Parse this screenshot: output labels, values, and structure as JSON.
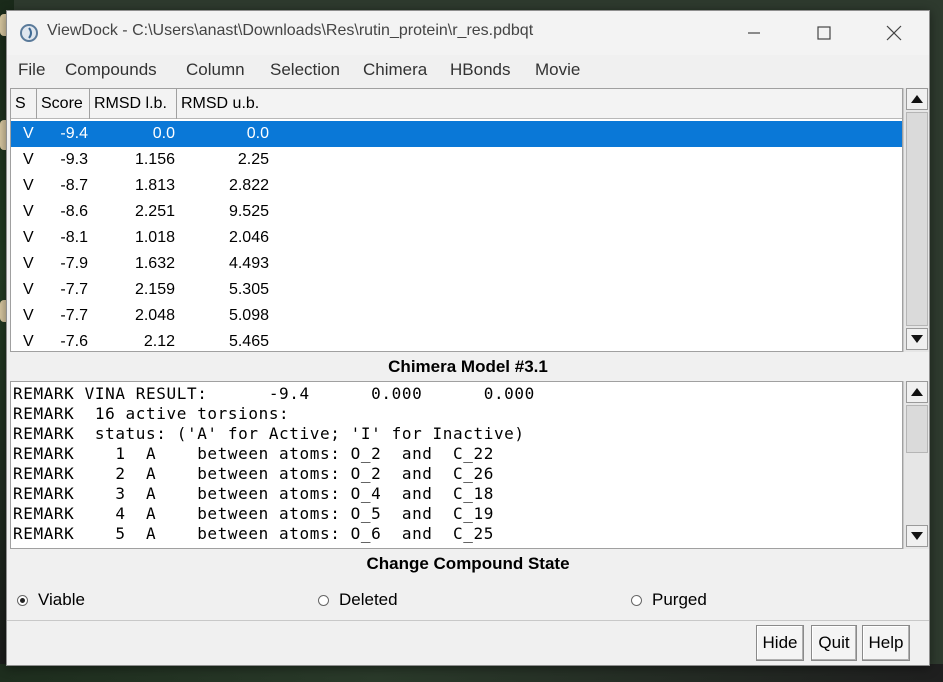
{
  "window": {
    "title": "ViewDock - C:\\Users\\anast\\Downloads\\Res\\rutin_protein\\r_res.pdbqt"
  },
  "menu": [
    "File",
    "Compounds",
    "Column",
    "Selection",
    "Chimera",
    "HBonds",
    "Movie"
  ],
  "table": {
    "headers": [
      "S",
      "Score",
      "RMSD l.b.",
      "RMSD u.b."
    ],
    "rows": [
      [
        "V",
        "-9.4",
        "0.0",
        "0.0"
      ],
      [
        "V",
        "-9.3",
        "1.156",
        "2.25"
      ],
      [
        "V",
        "-8.7",
        "1.813",
        "2.822"
      ],
      [
        "V",
        "-8.6",
        "2.251",
        "9.525"
      ],
      [
        "V",
        "-8.1",
        "1.018",
        "2.046"
      ],
      [
        "V",
        "-7.9",
        "1.632",
        "4.493"
      ],
      [
        "V",
        "-7.7",
        "2.159",
        "5.305"
      ],
      [
        "V",
        "-7.7",
        "2.048",
        "5.098"
      ],
      [
        "V",
        "-7.6",
        "2.12",
        "5.465"
      ]
    ]
  },
  "model_label": "Chimera Model #3.1",
  "remarks": [
    "REMARK VINA RESULT:      -9.4      0.000      0.000",
    "REMARK  16 active torsions:",
    "REMARK  status: ('A' for Active; 'I' for Inactive)",
    "REMARK    1  A    between atoms: O_2  and  C_22",
    "REMARK    2  A    between atoms: O_2  and  C_26",
    "REMARK    3  A    between atoms: O_4  and  C_18",
    "REMARK    4  A    between atoms: O_5  and  C_19",
    "REMARK    5  A    between atoms: O_6  and  C_25"
  ],
  "state_label": "Change Compound State",
  "states": [
    {
      "label": "Viable",
      "checked": true
    },
    {
      "label": "Deleted",
      "checked": false
    },
    {
      "label": "Purged",
      "checked": false
    }
  ],
  "buttons": {
    "hide": "Hide",
    "quit": "Quit",
    "help": "Help"
  },
  "colors": {
    "selection": "#0a78d7"
  }
}
